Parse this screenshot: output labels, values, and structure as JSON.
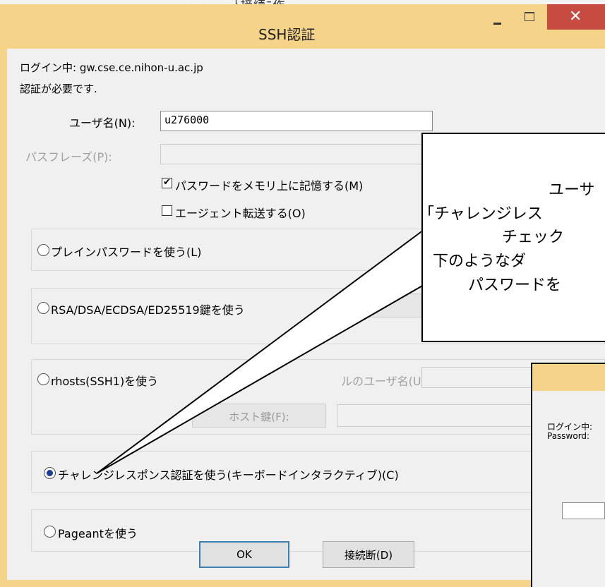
{
  "window": {
    "title": "SSH認証",
    "close_glyph": "✕"
  },
  "background": {
    "partial_title": "ｰ ｰ　　ﾄ接続ﾆ作"
  },
  "dialog": {
    "login_line": "ログイン中: gw.cse.ce.nihon-u.ac.jp",
    "auth_required": "認証が必要です.",
    "username_label": "ユーザ名(N):",
    "username_value": "u276000",
    "passphrase_label": "パスフレーズ(P):",
    "passphrase_value": "",
    "remember_checkbox": {
      "label": "パスワードをメモリ上に記憶する(M)",
      "checked": true
    },
    "agent_forward_checkbox": {
      "label": "エージェント転送する(O)",
      "checked": false
    },
    "methods": {
      "plain": "プレインパスワードを使う(L)",
      "rsa": "RSA/DSA/ECDSA/ED25519鍵を使う",
      "rhosts": "rhosts(SSH1)を使う",
      "rhosts_user_label": "ルのユーザ名(U):",
      "host_key_button": "ホスト鍵(F):",
      "challenge": "チャレンジレスポンス認証を使う(キーボードインタラクティブ)(C)",
      "pageant": "Pageantを使う",
      "selected": "challenge"
    },
    "ok_button": "OK",
    "disconnect_button": "接続断(D)"
  },
  "callout": {
    "lines": [
      "ユーサ",
      "「チャレンジレス",
      "チェック",
      "下のようなダ",
      "パスワードを"
    ]
  },
  "inset": {
    "login_label": "ログイン中:",
    "password_label": "Password:"
  }
}
